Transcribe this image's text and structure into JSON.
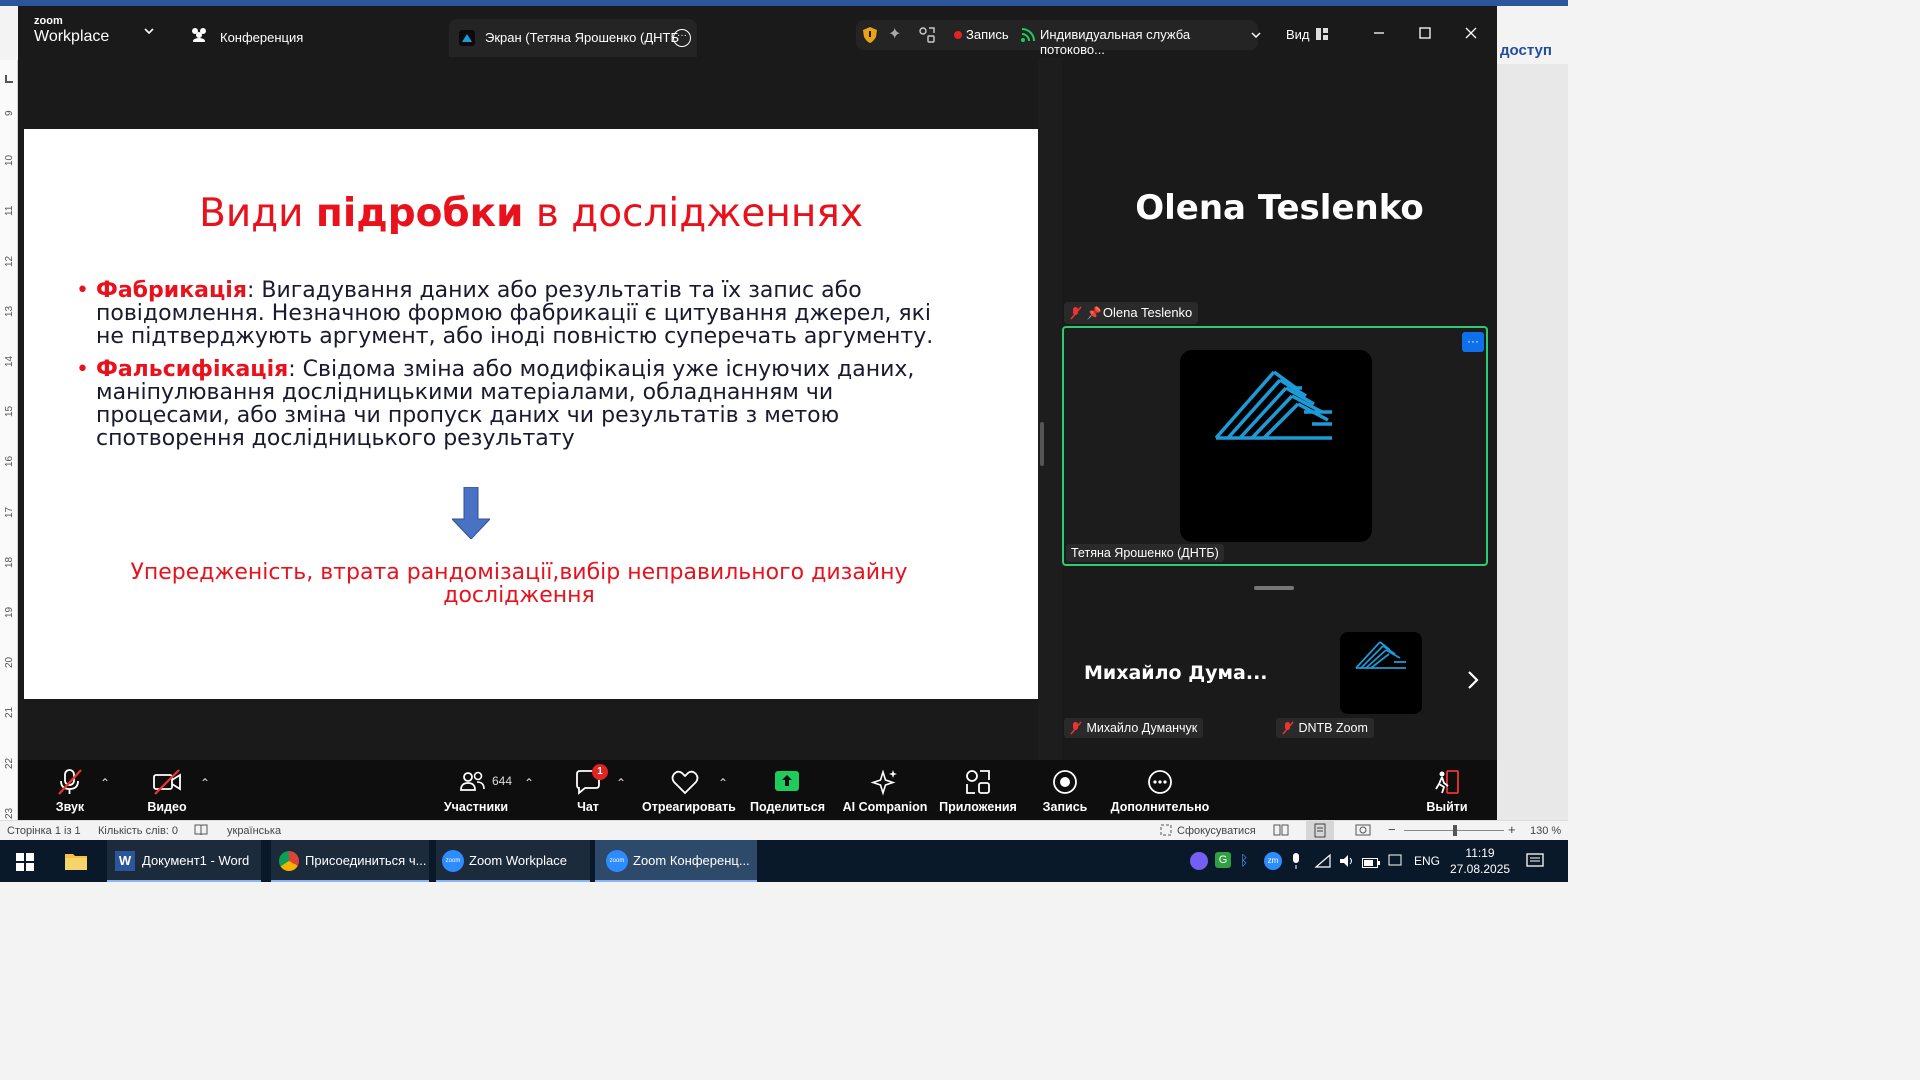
{
  "word": {
    "share_label": "доступ",
    "ruler_numbers": [
      "9",
      "10",
      "11",
      "12",
      "13",
      "14",
      "15",
      "16",
      "17",
      "18",
      "19",
      "20",
      "21",
      "22",
      "23"
    ],
    "status": {
      "page": "Сторінка 1 із 1",
      "words": "Кількість слів: 0",
      "language": "українська",
      "focus": "Сфокусуватися",
      "zoom": "130 %"
    }
  },
  "zoom": {
    "app_name_top": "zoom",
    "app_name_bottom": "Workplace",
    "conference_label": "Конференция",
    "share_tab_label": "Экран (Тетяна Ярошенко (ДНТБ",
    "record_label": "Запись",
    "stream_label": "Индивидуальная служба потоково...",
    "view_label": "Вид",
    "colors": {
      "accent_green": "#2ecc71",
      "record_red": "#e02424",
      "share_green": "#1fcb5d",
      "tile_blue": "#1e9ad6"
    }
  },
  "slide": {
    "title_part1": "Види ",
    "title_bold": "підробки",
    "title_part2": " в дослідженнях",
    "bullets": [
      {
        "term": "Фабрикація",
        "text": ": Вигадування даних або результатів та їх запис або повідомлення. Незначною формою фабрикації є цитування джерел, які не підтверджують аргумент, або іноді повністю суперечать аргументу."
      },
      {
        "term": "Фальсифікація",
        "text": ": Свідома зміна або модифікація уже існуючих даних, маніпулювання дослідницькими матеріалами, обладнанням чи процесами, або зміна чи пропуск даних чи результатів з метою спотворення дослідницького результату"
      }
    ],
    "conclusion": "Упередженість, втрата рандомізації,вибір неправильного дизайну дослідження"
  },
  "gallery": {
    "speaker_name": "Olena Teslenko",
    "pinned_label": "Olena Teslenko",
    "active_tile_name": "Тетяна Ярошенко (ДНТБ)",
    "more_button": "···",
    "thumb1_big_name": "Михайло  Дума...",
    "thumb1_label": "Михайло Думанчук",
    "thumb2_label": "DNTB Zoom"
  },
  "toolbar": {
    "audio": "Звук",
    "video": "Видео",
    "participants": "Участники",
    "participants_count": "644",
    "chat": "Чат",
    "chat_badge": "1",
    "react": "Отреагировать",
    "share": "Поделиться",
    "ai": "AI Companion",
    "apps": "Приложения",
    "record": "Запись",
    "more": "Дополнительно",
    "leave": "Выйти"
  },
  "taskbar": {
    "items": [
      {
        "label": "Документ1 - Word"
      },
      {
        "label": "Присоединиться ч..."
      },
      {
        "label": "Zoom Workplace"
      },
      {
        "label": "Zoom Конференц..."
      }
    ],
    "lang": "ENG",
    "time": "11:19",
    "date": "27.08.2025"
  }
}
